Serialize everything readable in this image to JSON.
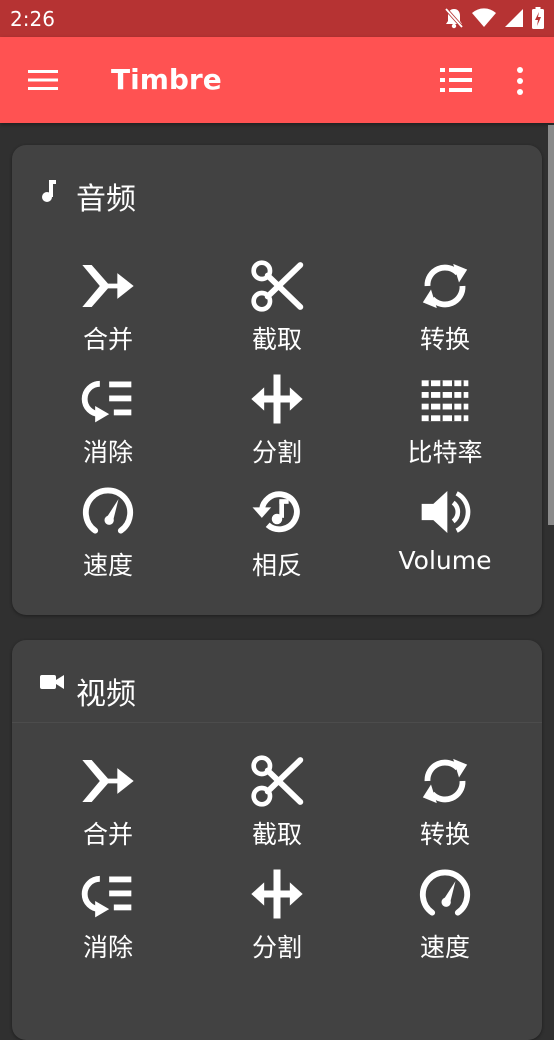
{
  "status_bar": {
    "time": "2:26"
  },
  "app_bar": {
    "title": "Timbre"
  },
  "audio_section": {
    "title": "音频",
    "items": [
      {
        "label": "合并",
        "icon": "merge-icon"
      },
      {
        "label": "截取",
        "icon": "scissors-icon"
      },
      {
        "label": "转换",
        "icon": "convert-icon"
      },
      {
        "label": "消除",
        "icon": "remove-icon"
      },
      {
        "label": "分割",
        "icon": "split-icon"
      },
      {
        "label": "比特率",
        "icon": "bitrate-icon"
      },
      {
        "label": "速度",
        "icon": "speed-icon"
      },
      {
        "label": "相反",
        "icon": "reverse-icon"
      },
      {
        "label": "Volume",
        "icon": "volume-icon"
      }
    ]
  },
  "video_section": {
    "title": "视频",
    "items": [
      {
        "label": "合并",
        "icon": "merge-icon"
      },
      {
        "label": "截取",
        "icon": "scissors-icon"
      },
      {
        "label": "转换",
        "icon": "convert-icon"
      },
      {
        "label": "消除",
        "icon": "remove-icon"
      },
      {
        "label": "分割",
        "icon": "split-icon"
      },
      {
        "label": "速度",
        "icon": "speed-icon"
      }
    ]
  },
  "colors": {
    "app_bar": "#ff5252",
    "status_bar": "#b63333",
    "background": "#303030",
    "card": "#424242"
  }
}
